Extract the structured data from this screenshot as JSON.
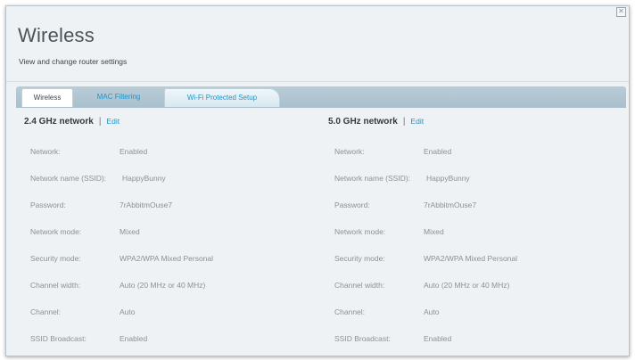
{
  "page": {
    "title": "Wireless",
    "subtitle": "View and change router settings"
  },
  "tabs": [
    {
      "label": "Wireless",
      "active": true
    },
    {
      "label": "MAC Filtering",
      "active": false
    },
    {
      "label": "Wi-Fi Protected Setup",
      "active": false
    }
  ],
  "separator": "|",
  "networks": [
    {
      "title": "2.4 GHz network",
      "edit_label": "Edit",
      "rows": [
        {
          "label": "Network:",
          "value": "Enabled"
        },
        {
          "label": "Network name (SSID):",
          "value": "HappyBunny"
        },
        {
          "label": "Password:",
          "value": "7rAbbitmOuse7"
        },
        {
          "label": "Network mode:",
          "value": "Mixed"
        },
        {
          "label": "Security mode:",
          "value": "WPA2/WPA Mixed Personal"
        },
        {
          "label": "Channel width:",
          "value": "Auto (20 MHz or 40 MHz)"
        },
        {
          "label": "Channel:",
          "value": "Auto"
        },
        {
          "label": "SSID Broadcast:",
          "value": "Enabled"
        }
      ]
    },
    {
      "title": "5.0 GHz network",
      "edit_label": "Edit",
      "rows": [
        {
          "label": "Network:",
          "value": "Enabled"
        },
        {
          "label": "Network name (SSID):",
          "value": "HappyBunny"
        },
        {
          "label": "Password:",
          "value": "7rAbbitmOuse7"
        },
        {
          "label": "Network mode:",
          "value": "Mixed"
        },
        {
          "label": "Security mode:",
          "value": "WPA2/WPA Mixed Personal"
        },
        {
          "label": "Channel width:",
          "value": "Auto (20 MHz or 40 MHz)"
        },
        {
          "label": "Channel:",
          "value": "Auto"
        },
        {
          "label": "SSID Broadcast:",
          "value": "Enabled"
        }
      ]
    }
  ],
  "colors": {
    "accent": "#1e94c8",
    "tabbar": "#b0c5d1",
    "panel_bg": "#eef2f4"
  },
  "icons": {
    "close": "close-icon"
  }
}
